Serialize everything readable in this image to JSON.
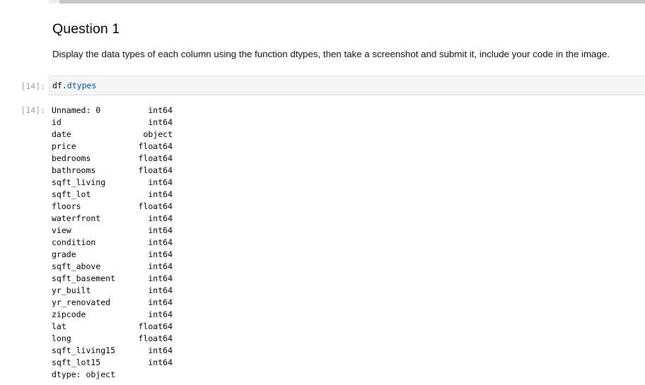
{
  "heading": "Question 1",
  "instructions": "Display the data types of each column using the function dtypes, then take a screenshot and submit it, include your code in the image.",
  "input_cell": {
    "prompt": "[14]:",
    "code_object": "df",
    "code_dot": ".",
    "code_attribute": "dtypes"
  },
  "output_cell": {
    "prompt": "[14]:",
    "rows": [
      {
        "name": "Unnamed: 0",
        "type": "int64"
      },
      {
        "name": "id",
        "type": "int64"
      },
      {
        "name": "date",
        "type": "object"
      },
      {
        "name": "price",
        "type": "float64"
      },
      {
        "name": "bedrooms",
        "type": "float64"
      },
      {
        "name": "bathrooms",
        "type": "float64"
      },
      {
        "name": "sqft_living",
        "type": "int64"
      },
      {
        "name": "sqft_lot",
        "type": "int64"
      },
      {
        "name": "floors",
        "type": "float64"
      },
      {
        "name": "waterfront",
        "type": "int64"
      },
      {
        "name": "view",
        "type": "int64"
      },
      {
        "name": "condition",
        "type": "int64"
      },
      {
        "name": "grade",
        "type": "int64"
      },
      {
        "name": "sqft_above",
        "type": "int64"
      },
      {
        "name": "sqft_basement",
        "type": "int64"
      },
      {
        "name": "yr_built",
        "type": "int64"
      },
      {
        "name": "yr_renovated",
        "type": "int64"
      },
      {
        "name": "zipcode",
        "type": "int64"
      },
      {
        "name": "lat",
        "type": "float64"
      },
      {
        "name": "long",
        "type": "float64"
      },
      {
        "name": "sqft_living15",
        "type": "int64"
      },
      {
        "name": "sqft_lot15",
        "type": "int64"
      }
    ],
    "footer": "dtype: object"
  }
}
